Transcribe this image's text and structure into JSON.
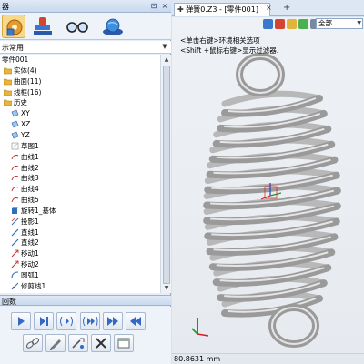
{
  "manager": {
    "title": "器",
    "pin_label": "⊡",
    "close_label": "×",
    "tabs": [
      {
        "icon": "cube-gear-icon"
      },
      {
        "icon": "stamp-icon"
      },
      {
        "icon": "glasses-icon"
      },
      {
        "icon": "globe-icon"
      }
    ],
    "filter_value": "示常用"
  },
  "tree": {
    "items": [
      {
        "label": "零件001",
        "indent": 2,
        "icon": "none"
      },
      {
        "label": "实体(4)",
        "indent": 4,
        "icon": "folder-icon"
      },
      {
        "label": "曲面(11)",
        "indent": 4,
        "icon": "folder-icon"
      },
      {
        "label": "线框(16)",
        "indent": 4,
        "icon": "folder-icon"
      },
      {
        "label": "历史",
        "indent": 4,
        "icon": "folder-icon"
      },
      {
        "label": "XY",
        "indent": 12,
        "icon": "plane-icon"
      },
      {
        "label": "XZ",
        "indent": 12,
        "icon": "plane-icon"
      },
      {
        "label": "YZ",
        "indent": 12,
        "icon": "plane-icon"
      },
      {
        "label": "草图1",
        "indent": 12,
        "icon": "sketch-icon"
      },
      {
        "label": "曲线1",
        "indent": 12,
        "icon": "curve-icon"
      },
      {
        "label": "曲线2",
        "indent": 12,
        "icon": "curve-icon"
      },
      {
        "label": "曲线3",
        "indent": 12,
        "icon": "curve-icon"
      },
      {
        "label": "曲线4",
        "indent": 12,
        "icon": "curve-icon"
      },
      {
        "label": "曲线5",
        "indent": 12,
        "icon": "curve-icon"
      },
      {
        "label": "旋转1_基体",
        "indent": 12,
        "icon": "revolve-icon"
      },
      {
        "label": "投影1",
        "indent": 12,
        "icon": "projection-icon"
      },
      {
        "label": "直线1",
        "indent": 12,
        "icon": "line-icon"
      },
      {
        "label": "直线2",
        "indent": 12,
        "icon": "line-icon"
      },
      {
        "label": "移动1",
        "indent": 12,
        "icon": "move-icon"
      },
      {
        "label": "移动2",
        "indent": 12,
        "icon": "move-icon"
      },
      {
        "label": "圆弧1",
        "indent": 12,
        "icon": "arc-icon"
      },
      {
        "label": "修剪线1",
        "indent": 12,
        "icon": "trim-icon"
      }
    ]
  },
  "params": {
    "label": "回数",
    "row1_icons": [
      "play-icon",
      "step-forward-icon",
      "replay-icon",
      "replay-all-icon",
      "fast-forward-icon",
      "rewind-icon"
    ],
    "row2_icons": [
      "chain-icon",
      "pencil-icon",
      "insert-icon",
      "delete-icon",
      "panel-icon"
    ]
  },
  "document": {
    "tab_label": "弹簧0.Z3 - [零件001]",
    "tab_pin": "✚",
    "close_label": "×",
    "new_tab_label": "+"
  },
  "viewport": {
    "toolbar_icons": [
      "filter-icon",
      "brush-icon",
      "paint-icon",
      "cube-icon",
      "display-icon"
    ],
    "filter_combo": "全部",
    "hint_line1": "<单击右键>环境相关选项",
    "hint_line2": "<Shift +鼠标右键>显示过滤器.",
    "coordinate_readout": "80.8631 mm"
  },
  "colors": {
    "accent": "#3568c4",
    "folder": "#e8b53a",
    "spring": "#9a9a9a"
  }
}
